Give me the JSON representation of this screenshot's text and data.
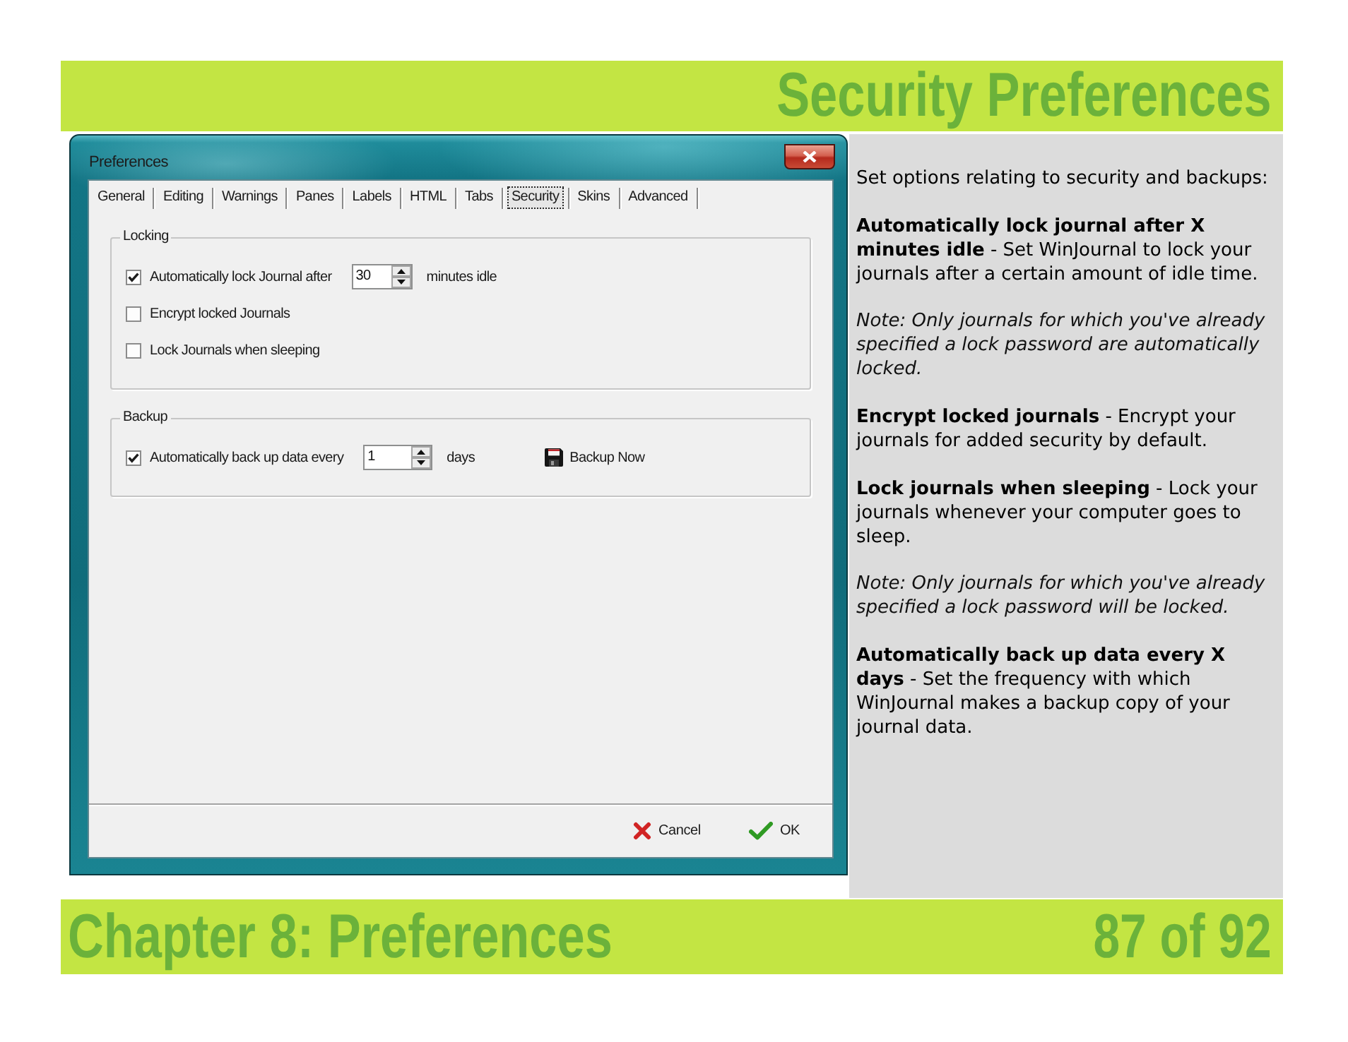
{
  "header": {
    "title": "Security Preferences"
  },
  "dialog": {
    "title": "Preferences",
    "tabs": [
      {
        "label": "General",
        "selected": false
      },
      {
        "label": "Editing",
        "selected": false
      },
      {
        "label": "Warnings",
        "selected": false
      },
      {
        "label": "Panes",
        "selected": false
      },
      {
        "label": "Labels",
        "selected": false
      },
      {
        "label": "HTML",
        "selected": false
      },
      {
        "label": "Tabs",
        "selected": false
      },
      {
        "label": "Security",
        "selected": true
      },
      {
        "label": "Skins",
        "selected": false
      },
      {
        "label": "Advanced",
        "selected": false
      }
    ],
    "groups": [
      {
        "title": "Locking",
        "options": [
          {
            "label": "Automatically lock Journal after",
            "checked": true,
            "spinner": {
              "value": "30"
            },
            "suffix": "minutes idle"
          },
          {
            "label": "Encrypt locked Journals",
            "checked": false
          },
          {
            "label": "Lock Journals when sleeping",
            "checked": false
          }
        ]
      },
      {
        "title": "Backup",
        "options": [
          {
            "label": "Automatically back up data every",
            "checked": true,
            "spinner": {
              "value": "1"
            },
            "suffix": "days",
            "button": "Backup Now"
          }
        ]
      }
    ],
    "buttons": [
      {
        "kind": "cancel",
        "label": "Cancel"
      },
      {
        "kind": "ok",
        "label": "OK"
      }
    ]
  },
  "description": {
    "paragraphs": [
      {
        "kind": "plain",
        "text": "Set options relating to security and backups:"
      },
      {
        "kind": "plain",
        "text": "**Automatically lock journal after X minutes idle** - Set WinJournal to lock your journals after a certain amount of idle time."
      },
      {
        "kind": "note",
        "text": "Note: Only journals for which you've already specified a lock password are automatically locked."
      },
      {
        "kind": "plain",
        "text": "**Encrypt locked journals** - Encrypt your journals for added security by default."
      },
      {
        "kind": "plain",
        "text": "**Lock journals when sleeping** - Lock your journals whenever your computer goes to sleep."
      },
      {
        "kind": "note",
        "text": "Note: Only journals for which you've already specified a lock password will be locked."
      },
      {
        "kind": "plain",
        "text": "**Automatically back up data every X days** - Set the frequency with which WinJournal makes a backup copy of your journal data."
      }
    ]
  },
  "footer": {
    "chapter": "Chapter 8: Preferences",
    "page": "87 of 92"
  }
}
